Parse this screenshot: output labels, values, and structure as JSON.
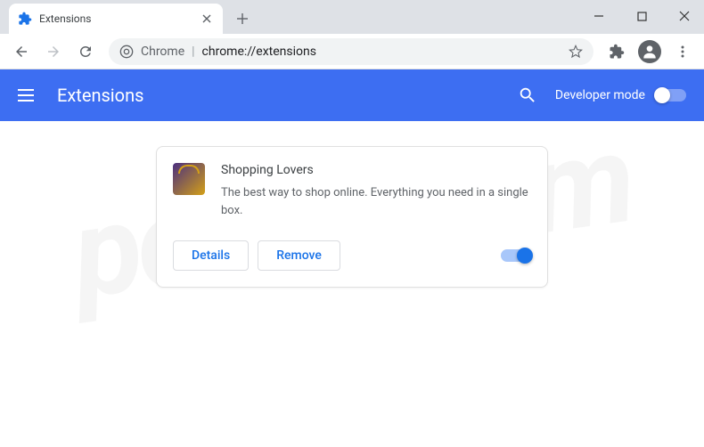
{
  "tab": {
    "title": "Extensions"
  },
  "omnibox": {
    "prefix": "Chrome",
    "url": "chrome://extensions"
  },
  "header": {
    "title": "Extensions",
    "dev_mode_label": "Developer mode"
  },
  "extension": {
    "name": "Shopping Lovers",
    "description": "The best way to shop online. Everything you need in a single box.",
    "details_label": "Details",
    "remove_label": "Remove",
    "enabled": true
  }
}
